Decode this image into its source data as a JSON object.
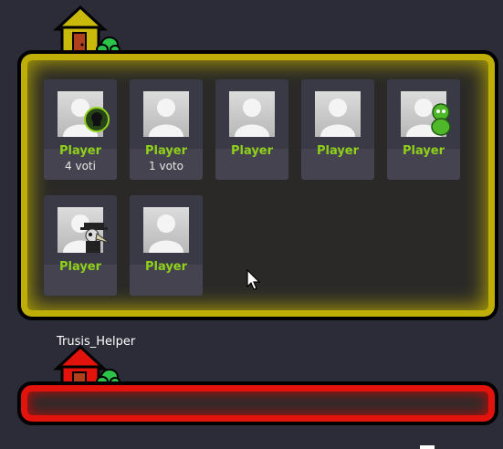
{
  "rooms": [
    {
      "border_color": "#bfae08",
      "house_color": "#b8a80a",
      "players": [
        {
          "name": "Player",
          "votes": "",
          "badge": "poison-skull-icon"
        },
        {
          "name": "Player",
          "votes": "",
          "badge": ""
        },
        {
          "name": "Player",
          "votes": "",
          "badge": ""
        },
        {
          "name": "Player",
          "votes": "",
          "badge": ""
        },
        {
          "name": "Player",
          "votes": "",
          "badge": "zombie-icon"
        },
        {
          "name": "Player",
          "votes": "",
          "badge": "plague-doctor-icon"
        },
        {
          "name": "Player",
          "votes": "",
          "badge": ""
        }
      ],
      "vote_labels": [
        "4 voti",
        "1 voto"
      ]
    },
    {
      "border_color": "#e2130c",
      "house_color": "#d8110b",
      "owner": "Trusis_Helper"
    }
  ]
}
